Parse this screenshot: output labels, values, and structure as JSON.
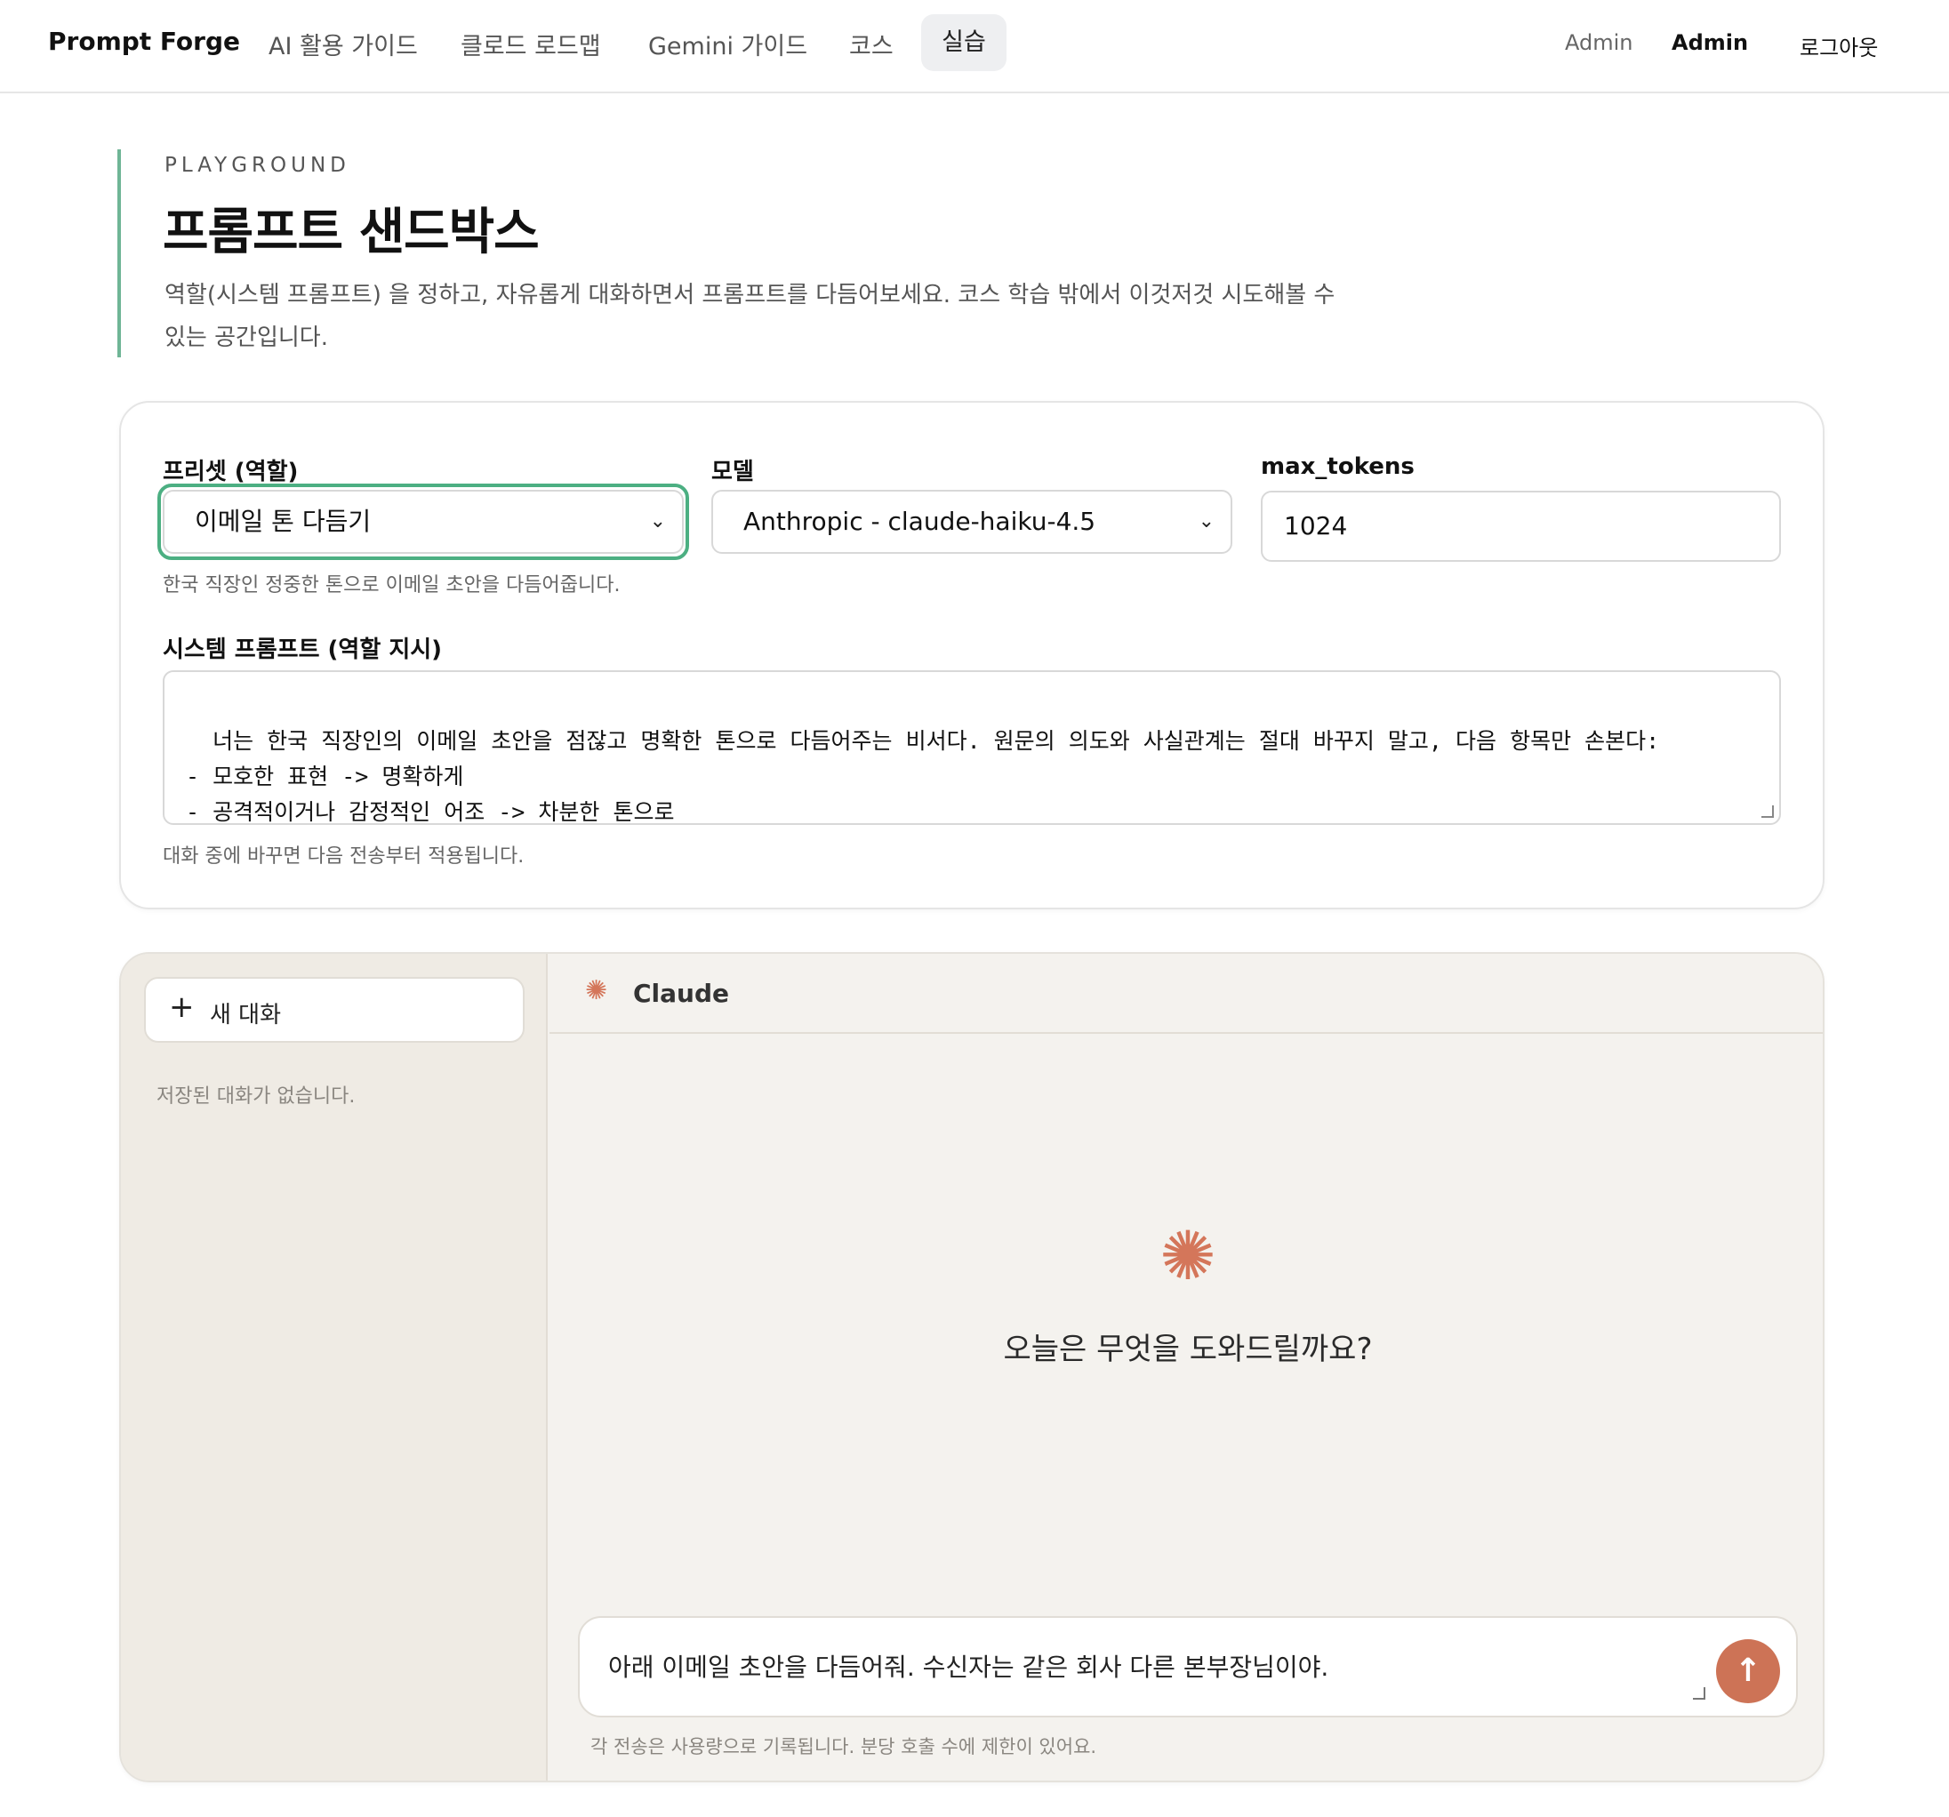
{
  "nav": {
    "brand": "Prompt Forge",
    "links": [
      "AI 활용 가이드",
      "클로드 로드맵",
      "Gemini 가이드",
      "코스"
    ],
    "active": "실습",
    "role": "Admin",
    "user": "Admin",
    "logout": "로그아웃"
  },
  "header": {
    "eyebrow": "PLAYGROUND",
    "title": "프롬프트 샌드박스",
    "description": "역할(시스템 프롬프트) 을 정하고, 자유롭게 대화하면서 프롬프트를 다듬어보세요. 코스 학습 밖에서 이것저것 시도해볼 수 있는 공간입니다."
  },
  "settings": {
    "preset_label": "프리셋 (역할)",
    "preset_value": "이메일 톤 다듬기",
    "preset_hint": "한국 직장인 정중한 톤으로 이메일 초안을 다듬어줍니다.",
    "model_label": "모델",
    "model_value": "Anthropic - claude-haiku-4.5",
    "max_tokens_label": "max_tokens",
    "max_tokens_value": "1024",
    "system_label": "시스템 프롬프트 (역할 지시)",
    "system_prompt": "너는 한국 직장인의 이메일 초안을 점잖고 명확한 톤으로 다듬어주는 비서다. 원문의 의도와 사실관계는 절대 바꾸지 말고, 다음 항목만 손본다:\n- 모호한 표현 -> 명확하게\n- 공격적이거나 감정적인 어조 -> 차분한 톤으로\n- 한국 비즈니스 이메일 관용 표현 (안녕하세요, 감사합니다 등) 보강",
    "system_hint": "대화 중에 바꾸면 다음 전송부터 적용됩니다."
  },
  "chat": {
    "new_chat": "새 대화",
    "empty": "저장된 대화가 없습니다.",
    "assistant_name": "Claude",
    "greeting": "오늘은 무엇을 도와드릴까요?",
    "input_value": "아래 이메일 초안을 다듬어줘. 수신자는 같은 회사 다른 본부장님이야.",
    "footnote": "각 전송은 사용량으로 기록됩니다. 분당 호출 수에 제한이 있어요.",
    "accent": "#cd7356"
  },
  "icons": {
    "chevron": "chevron-down-icon",
    "plus": "plus-icon",
    "claude": "claude-spark-icon",
    "send": "arrow-up-icon"
  }
}
